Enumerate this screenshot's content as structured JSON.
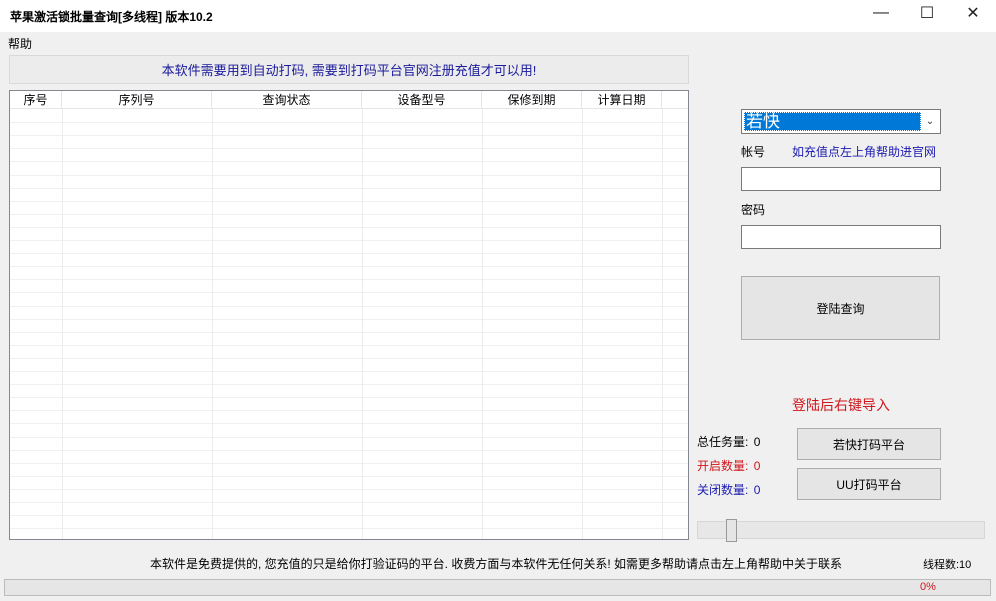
{
  "window": {
    "title": "苹果激活锁批量查询[多线程]  版本10.2",
    "minimize_glyph": "—",
    "maximize_glyph": "☐",
    "close_glyph": "✕"
  },
  "menu": {
    "help": "帮助"
  },
  "notice": "本软件需要用到自动打码, 需要到打码平台官网注册充值才可以用!",
  "table": {
    "columns": [
      "序号",
      "序列号",
      "查询状态",
      "设备型号",
      "保修到期",
      "计算日期"
    ],
    "rows": []
  },
  "platform_select": {
    "selected": "若快",
    "arrow": "⌄"
  },
  "account": {
    "label": "帐号",
    "hint": "如充值点左上角帮助进官网",
    "value": ""
  },
  "password": {
    "label": "密码",
    "value": ""
  },
  "login_button": "登陆查询",
  "after_login_hint": "登陆后右键导入",
  "stats": {
    "total_label": "总任务量:",
    "total_value": "0",
    "open_label": "开启数量:",
    "open_value": "0",
    "closed_label": "关闭数量:",
    "closed_value": "0"
  },
  "buttons": {
    "ruokuai": "若快打码平台",
    "uu": "UU打码平台"
  },
  "slider": {
    "value": 0.1
  },
  "footer": {
    "disclaimer": "本软件是免费提供的, 您充值的只是给你打验证码的平台. 收费方面与本软件无任何关系! 如需更多帮助请点击左上角帮助中关于联系",
    "threads": "线程数:10"
  },
  "progress": {
    "value": 0,
    "text": "0%"
  },
  "colors": {
    "accent": "#0078d7",
    "notice_blue": "#1a1a9c",
    "alert_red": "#d0161d"
  }
}
